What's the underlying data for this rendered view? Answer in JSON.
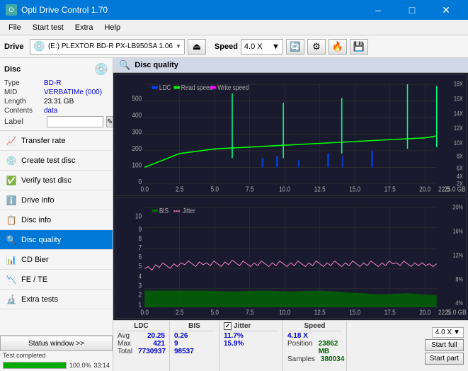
{
  "titleBar": {
    "title": "Opti Drive Control 1.70",
    "minimizeLabel": "–",
    "maximizeLabel": "□",
    "closeLabel": "✕"
  },
  "menuBar": {
    "items": [
      "File",
      "Start test",
      "Extra",
      "Help"
    ]
  },
  "toolbar": {
    "driveLabel": "Drive",
    "driveValue": "(E:)  PLEXTOR BD-R  PX-LB950SA 1.06",
    "speedLabel": "Speed",
    "speedValue": "4.0 X"
  },
  "disc": {
    "title": "Disc",
    "typeLabel": "Type",
    "typeValue": "BD-R",
    "midLabel": "MID",
    "midValue": "VERBATIMe (000)",
    "lengthLabel": "Length",
    "lengthValue": "23.31 GB",
    "contentsLabel": "Contents",
    "contentsValue": "data",
    "labelLabel": "Label",
    "labelValue": ""
  },
  "navItems": [
    {
      "id": "transfer-rate",
      "label": "Transfer rate",
      "icon": "📈"
    },
    {
      "id": "create-test-disc",
      "label": "Create test disc",
      "icon": "💿"
    },
    {
      "id": "verify-test-disc",
      "label": "Verify test disc",
      "icon": "✅"
    },
    {
      "id": "drive-info",
      "label": "Drive info",
      "icon": "ℹ️"
    },
    {
      "id": "disc-info",
      "label": "Disc info",
      "icon": "📋"
    },
    {
      "id": "disc-quality",
      "label": "Disc quality",
      "icon": "🔍",
      "active": true
    },
    {
      "id": "cd-bier",
      "label": "CD Bier",
      "icon": "📊"
    },
    {
      "id": "fe-te",
      "label": "FE / TE",
      "icon": "📉"
    },
    {
      "id": "extra-tests",
      "label": "Extra tests",
      "icon": "🔬"
    }
  ],
  "chartHeader": {
    "title": "Disc quality"
  },
  "chart1": {
    "title": "LDC",
    "legend": [
      "LDC",
      "Read speed",
      "Write speed"
    ],
    "yMax": 500,
    "xMax": 25,
    "rightAxisLabels": [
      "18X",
      "16X",
      "14X",
      "12X",
      "10X",
      "8X",
      "6X",
      "4X",
      "2X"
    ]
  },
  "chart2": {
    "title": "BIS / Jitter",
    "legend": [
      "BIS",
      "Jitter"
    ],
    "yMax": 10,
    "xMax": 25,
    "rightAxisLabels": [
      "20%",
      "16%",
      "12%",
      "8%",
      "4%"
    ]
  },
  "stats": {
    "columns": [
      "LDC",
      "BIS",
      "",
      "Jitter",
      "Speed",
      ""
    ],
    "rows": [
      {
        "label": "Avg",
        "ldc": "20.25",
        "bis": "0.26",
        "jitter": "11.7%",
        "speed": "4.18 X"
      },
      {
        "label": "Max",
        "ldc": "421",
        "bis": "9",
        "jitter": "15.9%",
        "position": "23862 MB"
      },
      {
        "label": "Total",
        "ldc": "7730937",
        "bis": "98537",
        "samples": "380034"
      }
    ],
    "jitterChecked": true,
    "speedCombo": "4.0 X",
    "startFullLabel": "Start full",
    "startPartLabel": "Start part"
  },
  "statusBar": {
    "statusWindowLabel": "Status window >>",
    "statusText": "Test completed",
    "progressValue": 100,
    "progressDisplay": "100.0%",
    "timeDisplay": "33:14"
  }
}
